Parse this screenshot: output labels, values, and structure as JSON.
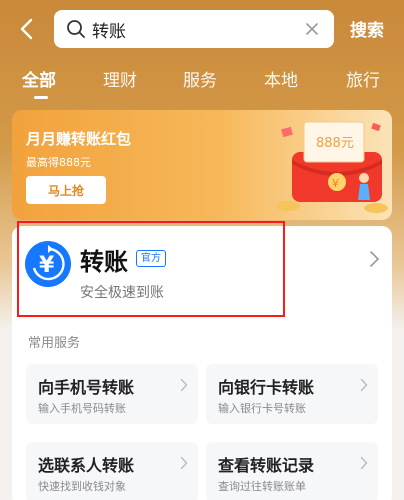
{
  "search": {
    "query": "转账",
    "submit_label": "搜索"
  },
  "tabs": [
    {
      "label": "全部",
      "active": true
    },
    {
      "label": "理财",
      "active": false
    },
    {
      "label": "服务",
      "active": false
    },
    {
      "label": "本地",
      "active": false
    },
    {
      "label": "旅行",
      "active": false
    }
  ],
  "promo": {
    "title": "月月赚转账红包",
    "subtitle": "最高得888元",
    "button_label": "马上抢",
    "amount_label": "888元",
    "coin_glyph": "¥"
  },
  "transfer": {
    "icon": "yuan-transfer-icon",
    "title": "转账",
    "badge": "官方",
    "subtitle": "安全极速到账",
    "icon_glyph": "¥"
  },
  "common_services": {
    "title": "常用服务",
    "items": [
      {
        "title": "向手机号转账",
        "desc": "输入手机号码转账"
      },
      {
        "title": "向银行卡转账",
        "desc": "输入银行卡号转账"
      },
      {
        "title": "选联系人转账",
        "desc": "快速找到收钱对象"
      },
      {
        "title": "查看转账记录",
        "desc": "查询过往转账账单"
      }
    ]
  },
  "colors": {
    "accent_blue": "#1677ff",
    "header_gold": "#c9893a",
    "highlight_red": "#ff1a1a"
  }
}
